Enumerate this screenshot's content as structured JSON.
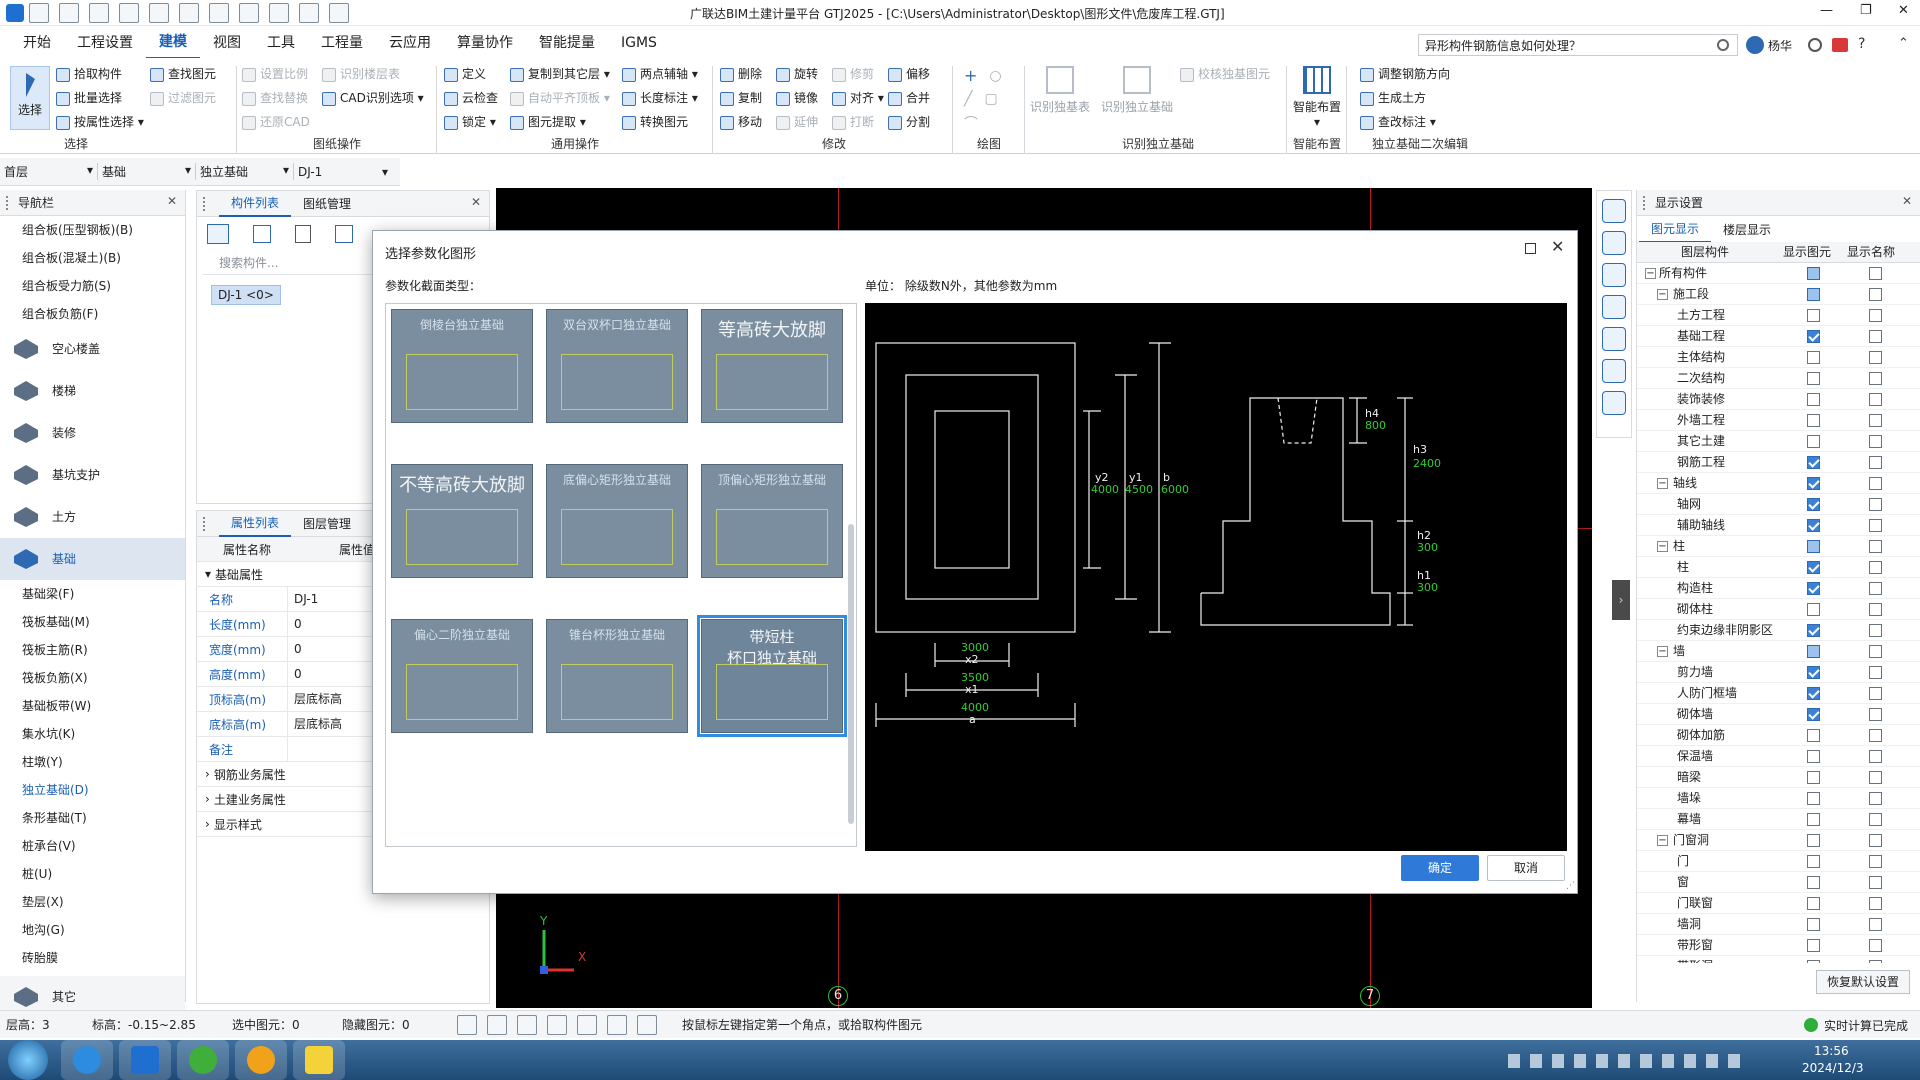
{
  "app": {
    "title": "广联达BIM土建计量平台 GTJ2025 - [C:\\Users\\Administrator\\Desktop\\图形文件\\危废库工程.GTJ]",
    "search_placeholder": "异形构件钢筋信息如何处理？",
    "user": "杨华",
    "win_controls": [
      "—",
      "❐",
      "✕"
    ]
  },
  "menu": [
    "开始",
    "工程设置",
    "建模",
    "视图",
    "工具",
    "工程量",
    "云应用",
    "算量协作",
    "智能提量",
    "IGMS"
  ],
  "ribbon": {
    "select": {
      "label": "选择",
      "items": [
        "拾取构件",
        "批量选择",
        "按属性选择"
      ],
      "big": "选择"
    },
    "drawing_ops": {
      "label": "图纸操作",
      "items": [
        "设置比例",
        "识别楼层表",
        "查找替换",
        "CAD识别选项",
        "还原CAD"
      ],
      "find": "查找图元",
      "filter": "过滤图元"
    },
    "common": {
      "label": "通用操作",
      "items": [
        "定义",
        "复制到其它层",
        "两点辅轴",
        "云检查",
        "自动平齐顶板",
        "长度标注",
        "锁定",
        "图元提取",
        "转换图元"
      ]
    },
    "modify": {
      "label": "修改",
      "items": [
        "删除",
        "旋转",
        "修剪",
        "偏移",
        "复制",
        "镜像",
        "对齐",
        "合并",
        "移动",
        "延伸",
        "打断",
        "分割"
      ]
    },
    "draw": {
      "label": "绘图"
    },
    "identify": {
      "label": "识别独立基础",
      "items": [
        "识别独基表",
        "识别独立基础",
        "校核独基图元"
      ]
    },
    "smart": {
      "label": "智能布置",
      "big": "智能布置"
    },
    "secondary": {
      "label": "独立基础二次编辑",
      "items": [
        "调整钢筋方向",
        "生成土方",
        "查改标注"
      ]
    }
  },
  "selectors": [
    "首层",
    "基础",
    "独立基础",
    "DJ-1"
  ],
  "nav": {
    "title": "导航栏",
    "top_items": [
      "组合板(压型钢板)(B)",
      "组合板(混凝土)(B)",
      "组合板受力筋(S)",
      "组合板负筋(F)"
    ],
    "categories": [
      "空心楼盖",
      "楼梯",
      "装修",
      "基坑支护",
      "土方",
      "基础"
    ],
    "found_items": [
      "基础梁(F)",
      "筏板基础(M)",
      "筏板主筋(R)",
      "筏板负筋(X)",
      "基础板带(W)",
      "集水坑(K)",
      "柱墩(Y)",
      "独立基础(D)",
      "条形基础(T)",
      "桩承台(V)",
      "桩(U)",
      "垫层(X)",
      "地沟(G)",
      "砖胎膜"
    ],
    "active_item": "独立基础(D)",
    "other": "其它"
  },
  "component": {
    "tabs": [
      "构件列表",
      "图纸管理"
    ],
    "search_placeholder": "搜索构件...",
    "item": "DJ-1 <0>"
  },
  "props": {
    "tabs": [
      "属性列表",
      "图层管理"
    ],
    "header": [
      "属性名称",
      "属性值"
    ],
    "group": "基础属性",
    "rows": [
      {
        "k": "名称",
        "v": "DJ-1"
      },
      {
        "k": "长度(mm)",
        "v": "0"
      },
      {
        "k": "宽度(mm)",
        "v": "0"
      },
      {
        "k": "高度(mm)",
        "v": "0"
      },
      {
        "k": "顶标高(m)",
        "v": "层底标高"
      },
      {
        "k": "底标高(m)",
        "v": "层底标高"
      },
      {
        "k": "备注",
        "v": ""
      }
    ],
    "collapsed": [
      "钢筋业务属性",
      "土建业务属性",
      "显示样式"
    ]
  },
  "dialog": {
    "title": "选择参数化图形",
    "section_label": "参数化截面类型：",
    "unit_note": "单位：  除级数N外，其他参数为mm",
    "thumbnails": [
      "倒棱台独立基础",
      "双台双杯口独立基础",
      "等高砖大放脚",
      "不等高砖大放脚",
      "底偏心矩形独立基础",
      "顶偏心矩形独立基础",
      "偏心二阶独立基础",
      "锥台杯形独立基础",
      "带短柱\n杯口独立基础"
    ],
    "selected_index": 8,
    "ok": "确定",
    "cancel": "取消",
    "params": {
      "y2": "y2",
      "y2_val": "4000",
      "y1": "y1",
      "y1_val": "4500",
      "b": "b",
      "b_val": "6000",
      "x2": "x2",
      "x2_val": "3000",
      "x1": "x1",
      "x1_val": "3500",
      "a": "a",
      "a_val": "4000",
      "h4": "h4",
      "h4_val": "800",
      "h3": "h3",
      "h3_val": "2400",
      "h2": "h2",
      "h2_val": "300",
      "h1": "h1",
      "h1_val": "300"
    }
  },
  "canvas": {
    "axis_labels": [
      "6",
      "7"
    ],
    "axis_y": "Y",
    "axis_x": "X"
  },
  "display": {
    "title": "显示设置",
    "tabs": [
      "图元显示",
      "楼层显示"
    ],
    "columns": [
      "图层构件",
      "显示图元",
      "显示名称"
    ],
    "rows": [
      {
        "name": "所有构件",
        "level": 0,
        "exp": "−",
        "show": "part",
        "label": false
      },
      {
        "name": "施工段",
        "level": 1,
        "exp": "−",
        "show": "part",
        "label": false
      },
      {
        "name": "土方工程",
        "level": 2,
        "show": false,
        "label": false
      },
      {
        "name": "基础工程",
        "level": 2,
        "show": true,
        "label": false
      },
      {
        "name": "主体结构",
        "level": 2,
        "show": false,
        "label": false
      },
      {
        "name": "二次结构",
        "level": 2,
        "show": false,
        "label": false
      },
      {
        "name": "装饰装修",
        "level": 2,
        "show": false,
        "label": false
      },
      {
        "name": "外墙工程",
        "level": 2,
        "show": false,
        "label": false
      },
      {
        "name": "其它土建",
        "level": 2,
        "show": false,
        "label": false
      },
      {
        "name": "钢筋工程",
        "level": 2,
        "show": true,
        "label": false
      },
      {
        "name": "轴线",
        "level": 1,
        "exp": "−",
        "show": true,
        "label": false
      },
      {
        "name": "轴网",
        "level": 2,
        "show": true,
        "label": false
      },
      {
        "name": "辅助轴线",
        "level": 2,
        "show": true,
        "label": false
      },
      {
        "name": "柱",
        "level": 1,
        "exp": "−",
        "show": "part",
        "label": false
      },
      {
        "name": "柱",
        "level": 2,
        "show": true,
        "label": false
      },
      {
        "name": "构造柱",
        "level": 2,
        "show": true,
        "label": false
      },
      {
        "name": "砌体柱",
        "level": 2,
        "show": false,
        "label": false
      },
      {
        "name": "约束边缘非阴影区",
        "level": 2,
        "show": true,
        "label": false
      },
      {
        "name": "墙",
        "level": 1,
        "exp": "−",
        "show": "part",
        "label": false
      },
      {
        "name": "剪力墙",
        "level": 2,
        "show": true,
        "label": false
      },
      {
        "name": "人防门框墙",
        "level": 2,
        "show": true,
        "label": false
      },
      {
        "name": "砌体墙",
        "level": 2,
        "show": true,
        "label": false
      },
      {
        "name": "砌体加筋",
        "level": 2,
        "show": false,
        "label": false
      },
      {
        "name": "保温墙",
        "level": 2,
        "show": false,
        "label": false
      },
      {
        "name": "暗梁",
        "level": 2,
        "show": false,
        "label": false
      },
      {
        "name": "墙垛",
        "level": 2,
        "show": false,
        "label": false
      },
      {
        "name": "幕墙",
        "level": 2,
        "show": false,
        "label": false
      },
      {
        "name": "门窗洞",
        "level": 1,
        "exp": "−",
        "show": false,
        "label": false
      },
      {
        "name": "门",
        "level": 2,
        "show": false,
        "label": false
      },
      {
        "name": "窗",
        "level": 2,
        "show": false,
        "label": false
      },
      {
        "name": "门联窗",
        "level": 2,
        "show": false,
        "label": false
      },
      {
        "name": "墙洞",
        "level": 2,
        "show": false,
        "label": false
      },
      {
        "name": "带形窗",
        "level": 2,
        "show": false,
        "label": false
      },
      {
        "name": "带形洞",
        "level": 2,
        "show": false,
        "label": false
      }
    ],
    "restore": "恢复默认设置"
  },
  "status": {
    "floor": "层高：3",
    "elev": "标高：-0.15~2.85",
    "selected": "选中图元：0",
    "hidden": "隐藏图元：0",
    "hint": "按鼠标左键指定第一个角点，或拾取构件图元",
    "calc": "实时计算已完成"
  },
  "taskbar": {
    "time": "13:56",
    "date": "2024/12/3"
  },
  "colors": {
    "accent": "#1a5fb4",
    "canvas": "#000000",
    "dim_green": "#33cc33",
    "thumb": "#7a8e9f",
    "axis_red": "#c81e1e"
  }
}
